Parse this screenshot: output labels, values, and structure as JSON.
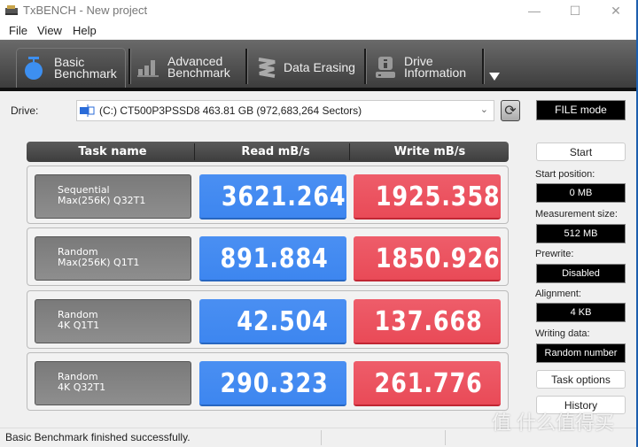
{
  "window": {
    "title": "TxBENCH - New project",
    "controls": {
      "minimize": "—",
      "maximize": "☐",
      "close": "✕"
    }
  },
  "menu": [
    "File",
    "View",
    "Help"
  ],
  "toolbar": {
    "tabs": [
      {
        "line1": "Basic",
        "line2": "Benchmark",
        "icon": "stopwatch-icon",
        "active": true
      },
      {
        "line1": "Advanced",
        "line2": "Benchmark",
        "icon": "bar-chart-icon",
        "active": false
      },
      {
        "line1": "Data Erasing",
        "line2": "",
        "icon": "eraser-icon",
        "active": false
      },
      {
        "line1": "Drive",
        "line2": "Information",
        "icon": "drive-info-icon",
        "active": false
      }
    ],
    "more_icon": "triangle-down-icon"
  },
  "drive": {
    "label": "Drive:",
    "selected": "(C:) CT500P3PSSD8  463.81 GB (972,683,264 Sectors)",
    "mode": "FILE mode"
  },
  "table": {
    "headers": [
      "Task name",
      "Read mB/s",
      "Write mB/s"
    ],
    "rows": [
      {
        "name1": "Sequential",
        "name2": "Max(256K) Q32T1",
        "read": "3621.264",
        "write": "1925.358"
      },
      {
        "name1": "Random",
        "name2": "Max(256K) Q1T1",
        "read": "891.884",
        "write": "1850.926"
      },
      {
        "name1": "Random",
        "name2": "4K Q1T1",
        "read": "42.504",
        "write": "137.668"
      },
      {
        "name1": "Random",
        "name2": "4K Q32T1",
        "read": "290.323",
        "write": "261.776"
      }
    ]
  },
  "side": {
    "start": "Start",
    "start_position_label": "Start position:",
    "start_position": "0 MB",
    "measurement_size_label": "Measurement size:",
    "measurement_size": "512 MB",
    "prewrite_label": "Prewrite:",
    "prewrite": "Disabled",
    "alignment_label": "Alignment:",
    "alignment": "4 KB",
    "writing_data_label": "Writing data:",
    "writing_data": "Random number",
    "task_options": "Task options",
    "history": "History"
  },
  "status": {
    "text": "Basic Benchmark finished successfully."
  },
  "watermark": "值 什么值得买"
}
